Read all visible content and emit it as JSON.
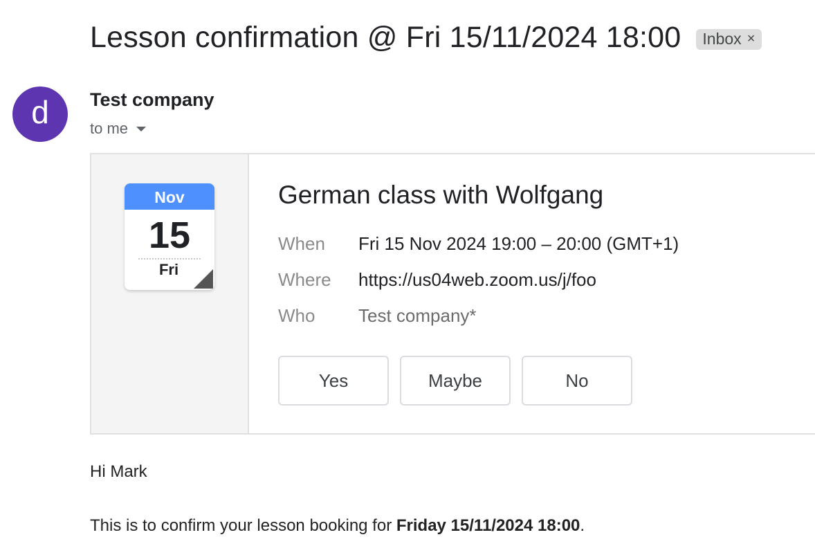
{
  "email": {
    "subject": "Lesson confirmation @ Fri 15/11/2024 18:00",
    "label": "Inbox",
    "label_remove": "×",
    "sender": {
      "avatar_letter": "d",
      "avatar_color": "#5e35b1",
      "name": "Test company",
      "recipient": "to me"
    }
  },
  "invite": {
    "calendar_icon": {
      "month": "Nov",
      "day": "15",
      "weekday": "Fri",
      "header_color": "#4d90fe"
    },
    "title": "German class with Wolfgang",
    "details": [
      {
        "label": "When",
        "value": "Fri 15 Nov 2024 19:00 – 20:00 (GMT+1)"
      },
      {
        "label": "Where",
        "value": "https://us04web.zoom.us/j/foo"
      },
      {
        "label": "Who",
        "value": "Test company*"
      }
    ],
    "rsvp": {
      "yes": "Yes",
      "maybe": "Maybe",
      "no": "No"
    }
  },
  "body": {
    "greeting": "Hi Mark",
    "confirm_prefix": "This is to confirm your lesson booking for ",
    "confirm_bold": "Friday 15/11/2024 18:00",
    "confirm_suffix": "."
  }
}
